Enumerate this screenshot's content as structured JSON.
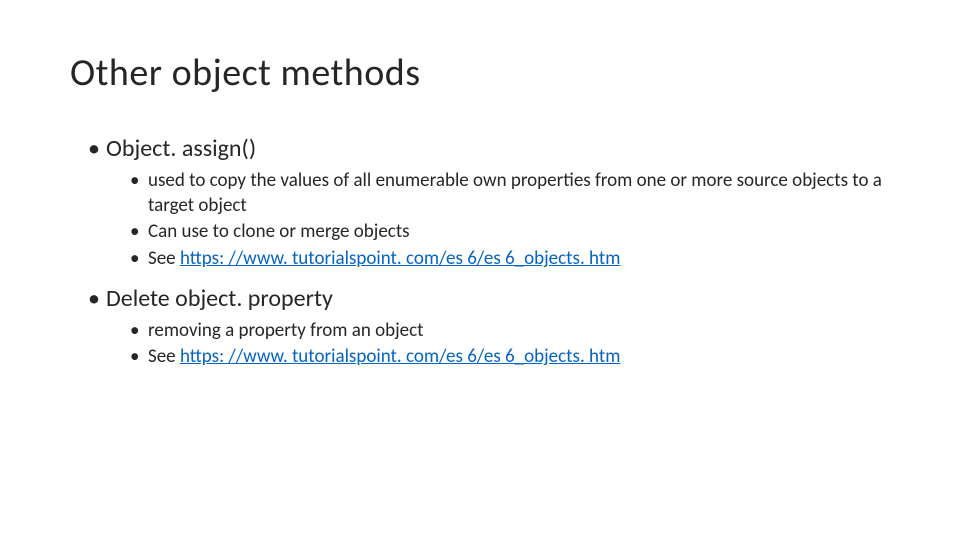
{
  "title": "Other object methods",
  "items": {
    "assign": {
      "label": "Object. assign()",
      "sub1": "used to copy the values of all enumerable own properties from one or more source objects to a target object",
      "sub2": "Can use to clone or merge objects",
      "sub3_prefix": "See ",
      "sub3_link": "https: //www. tutorialspoint. com/es 6/es 6_objects. htm"
    },
    "delete": {
      "label": "Delete object. property",
      "sub1": "removing a property from an object",
      "sub2_prefix": "See ",
      "sub2_link": "https: //www. tutorialspoint. com/es 6/es 6_objects. htm"
    }
  }
}
